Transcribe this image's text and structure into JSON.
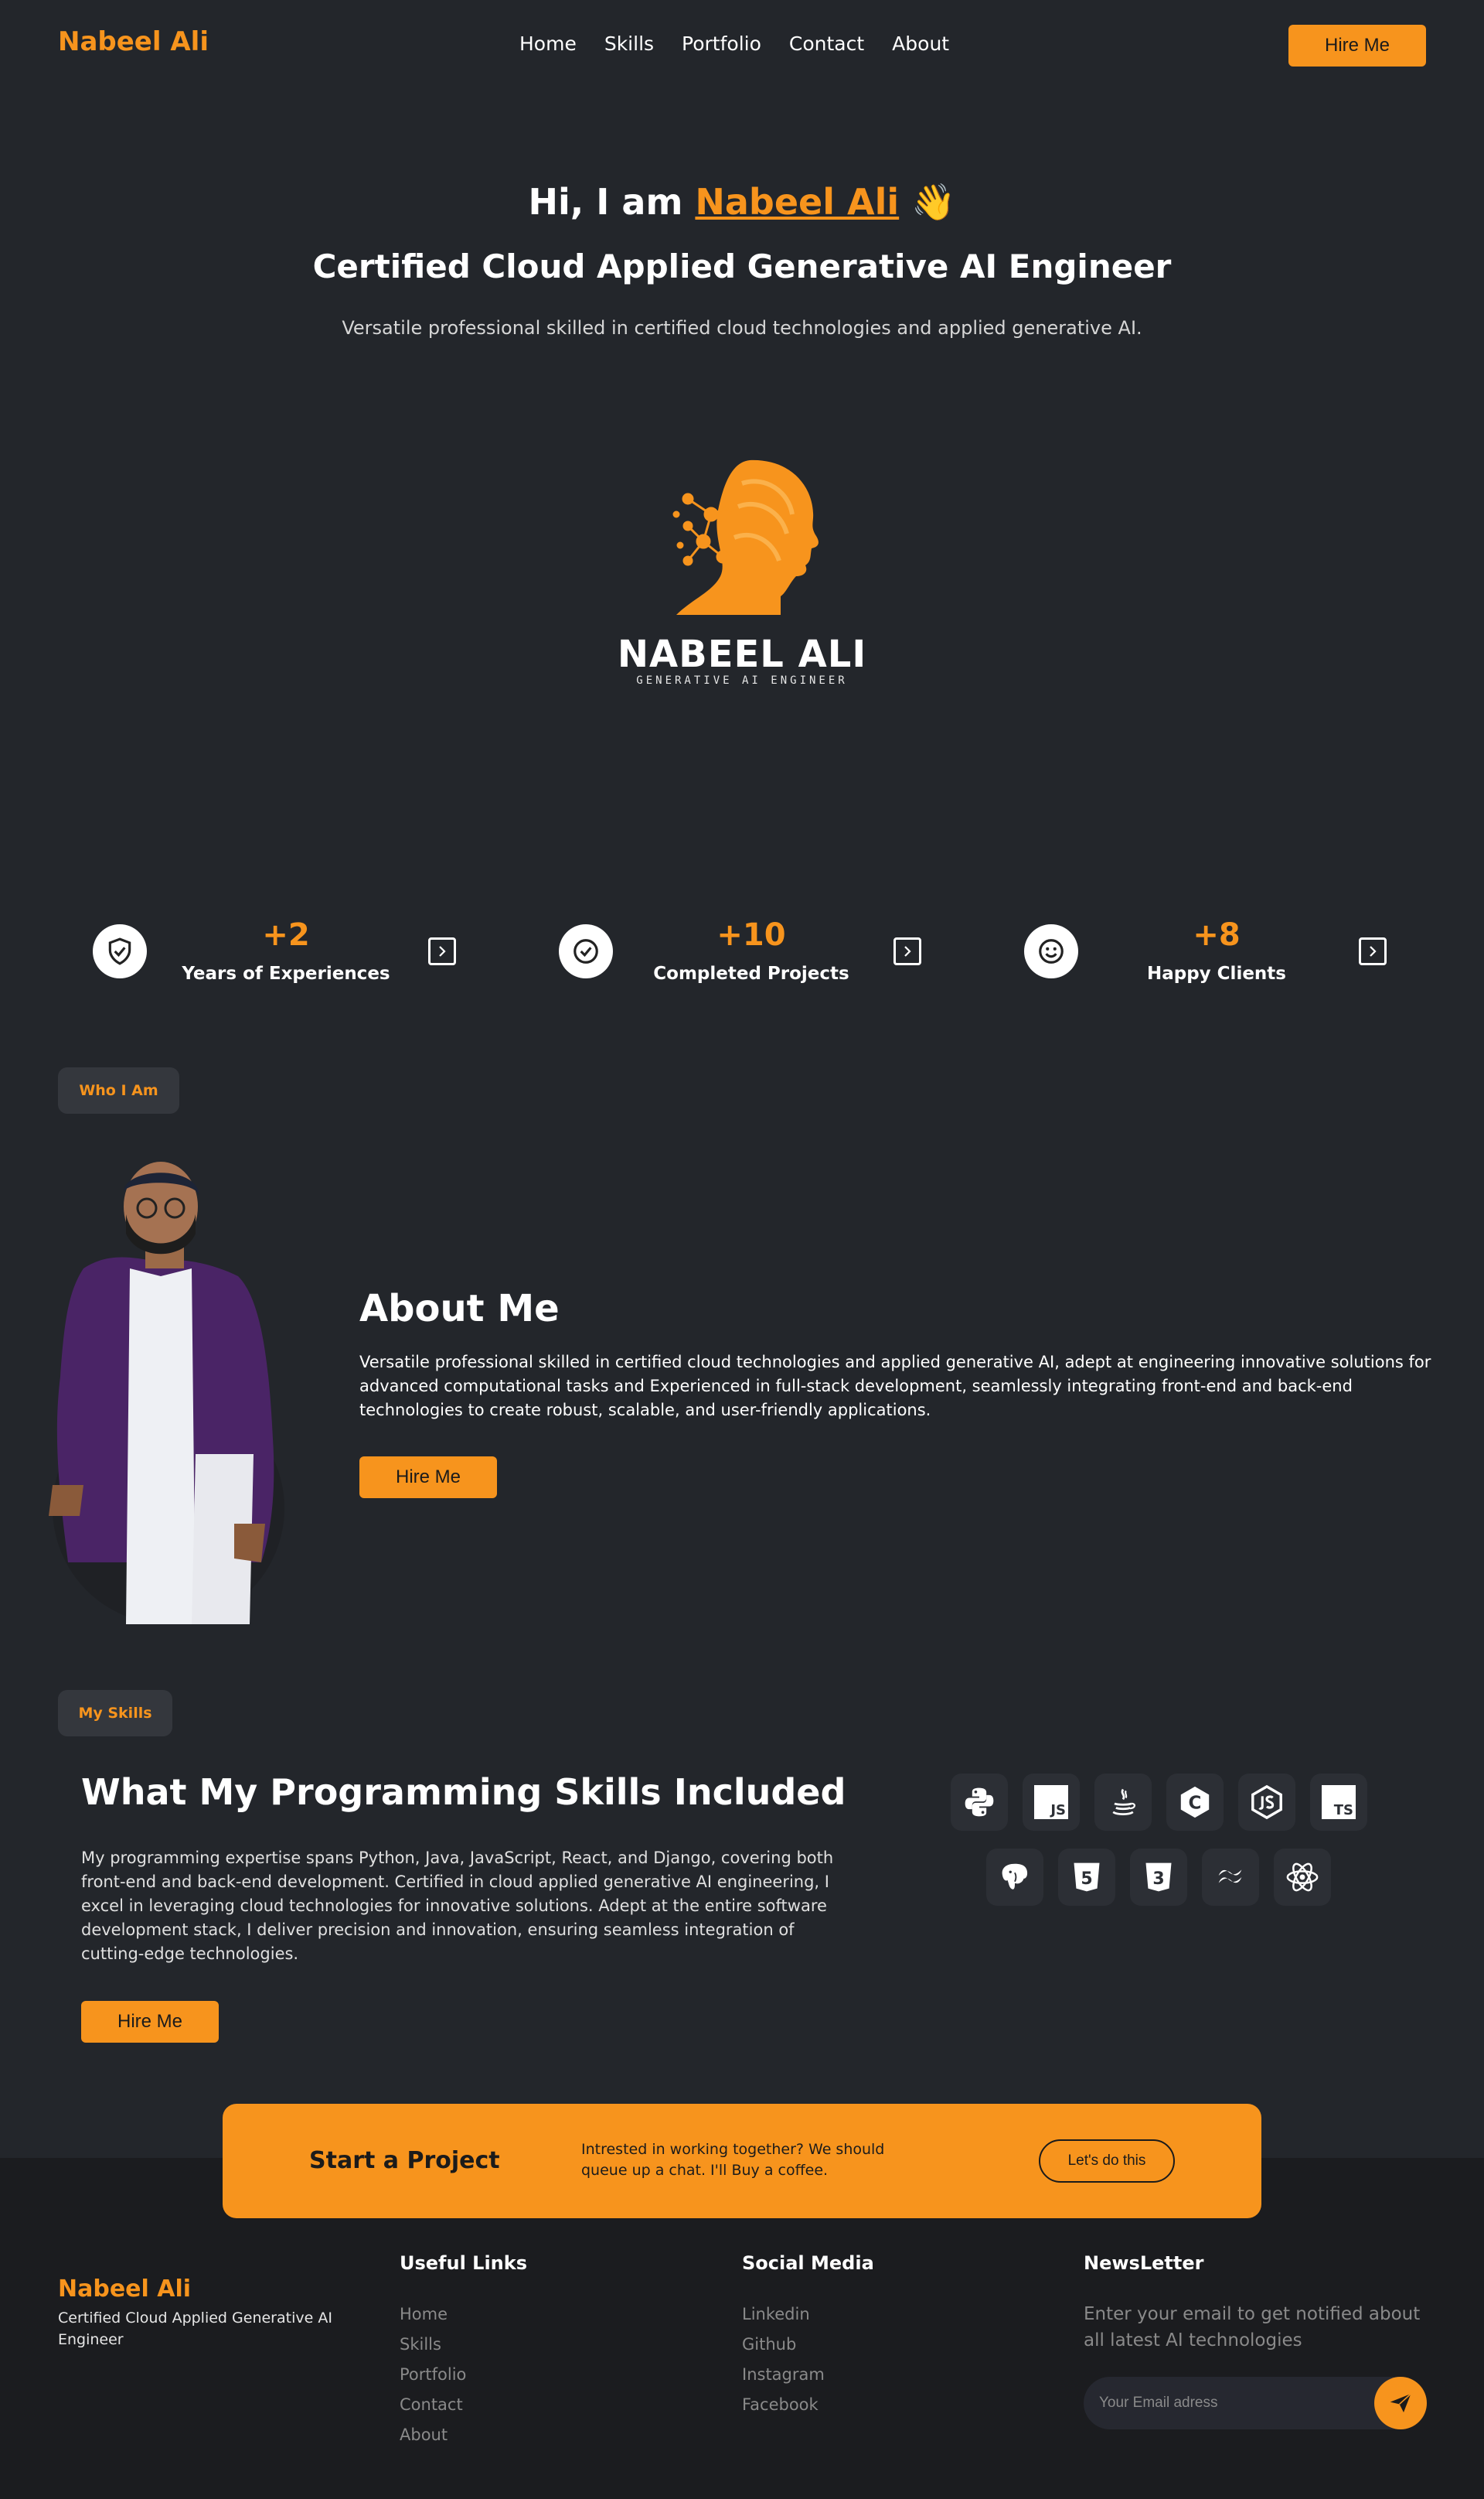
{
  "nav": {
    "brand": "Nabeel Ali",
    "links": [
      "Home",
      "Skills",
      "Portfolio",
      "Contact",
      "About"
    ],
    "hire": "Hire Me"
  },
  "hero": {
    "greeting": "Hi, I am ",
    "name": "Nabeel Ali",
    "emoji": "👋",
    "title": "Certified Cloud Applied Generative AI Engineer",
    "subtitle": "Versatile professional skilled in certified cloud technologies and applied generative AI.",
    "logo_name": "NABEEL ALI",
    "logo_tag": "GENERATIVE AI ENGINEER"
  },
  "stats": [
    {
      "num": "+2",
      "label": "Years of Experiences",
      "icon": "shield-check-icon"
    },
    {
      "num": "+10",
      "label": "Completed Projects",
      "icon": "check-circle-icon"
    },
    {
      "num": "+8",
      "label": "Happy Clients",
      "icon": "smile-icon"
    }
  ],
  "about": {
    "pill": "Who I Am",
    "title": "About Me",
    "text": "Versatile professional skilled in certified cloud technologies and applied generative AI, adept at engineering innovative solutions for advanced computational tasks and Experienced in full-stack development, seamlessly integrating front-end and back-end technologies to create robust, scalable, and user-friendly applications.",
    "hire": "Hire Me"
  },
  "skills": {
    "pill": "My Skills",
    "title": "What My Programming Skills Included",
    "text": "My programming expertise spans Python, Java, JavaScript, React, and Django, covering both front-end and back-end development. Certified in cloud applied generative AI engineering, I excel in leveraging cloud technologies for innovative solutions. Adept at the entire software development stack, I deliver precision and innovation, ensuring seamless integration of cutting-edge technologies.",
    "hire": "Hire Me",
    "icons": [
      "python-icon",
      "javascript-icon",
      "java-icon",
      "c-icon",
      "nodejs-icon",
      "typescript-icon",
      "postgresql-icon",
      "html5-icon",
      "css3-icon",
      "tailwind-icon",
      "react-icon"
    ],
    "js_label": "JS",
    "ts_label": "TS",
    "html_label": "5",
    "css_label": "3",
    "c_label": "C"
  },
  "cta": {
    "title": "Start a Project",
    "text": "Intrested in working together? We should queue up a chat. I'll Buy a coffee.",
    "button": "Let's do this"
  },
  "footer": {
    "brand": "Nabeel Ali",
    "tagline": "Certified Cloud Applied Generative AI Engineer",
    "useful_title": "Useful Links",
    "useful": [
      "Home",
      "Skills",
      "Portfolio",
      "Contact",
      "About"
    ],
    "social_title": "Social Media",
    "social": [
      "Linkedin",
      "Github",
      "Instagram",
      "Facebook"
    ],
    "news_title": "NewsLetter",
    "news_text": "Enter your email to get notified about all latest AI technologies",
    "email_placeholder": "Your Email adress"
  },
  "colors": {
    "accent": "#f7941d",
    "background": "#23262b",
    "footer": "#1b1c1f"
  }
}
